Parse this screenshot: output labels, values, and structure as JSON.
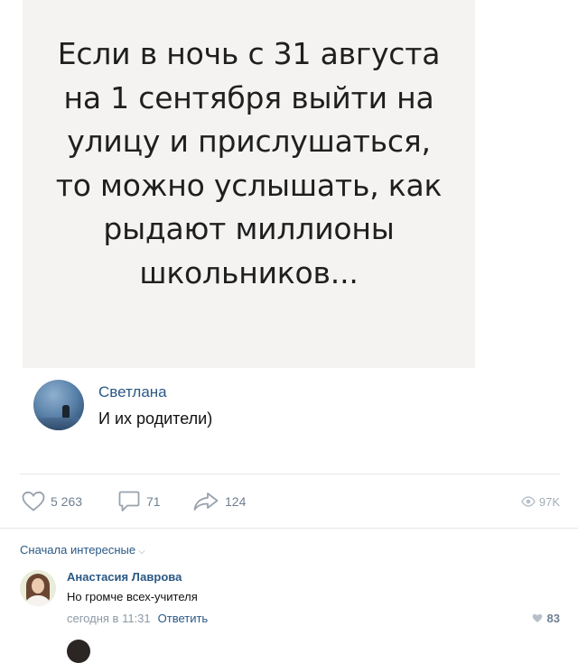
{
  "post": {
    "image_lines": [
      "Если в ночь с 31 августа",
      "на 1 сентября выйти на",
      "улицу и прислушаться,",
      "то можно услышать, как",
      "рыдают миллионы",
      "школьников..."
    ]
  },
  "top_comment": {
    "author": "Светлана",
    "text": "И их родители)"
  },
  "actions": {
    "likes": "5 263",
    "comments": "71",
    "shares": "124",
    "views": "97K"
  },
  "comments_section": {
    "sort_label": "Сначала интересные",
    "chevron": "⌵"
  },
  "reply": {
    "author": "Анастасия Лаврова",
    "text": "Но громче всех-учителя",
    "time": "сегодня в 11:31",
    "reply_label": "Ответить",
    "likes": "83"
  },
  "colors": {
    "link": "#2a5885",
    "muted": "#6f7f91",
    "icon": "#99a2ad"
  },
  "icons": [
    "heart-icon",
    "comment-icon",
    "share-icon",
    "eye-icon"
  ]
}
